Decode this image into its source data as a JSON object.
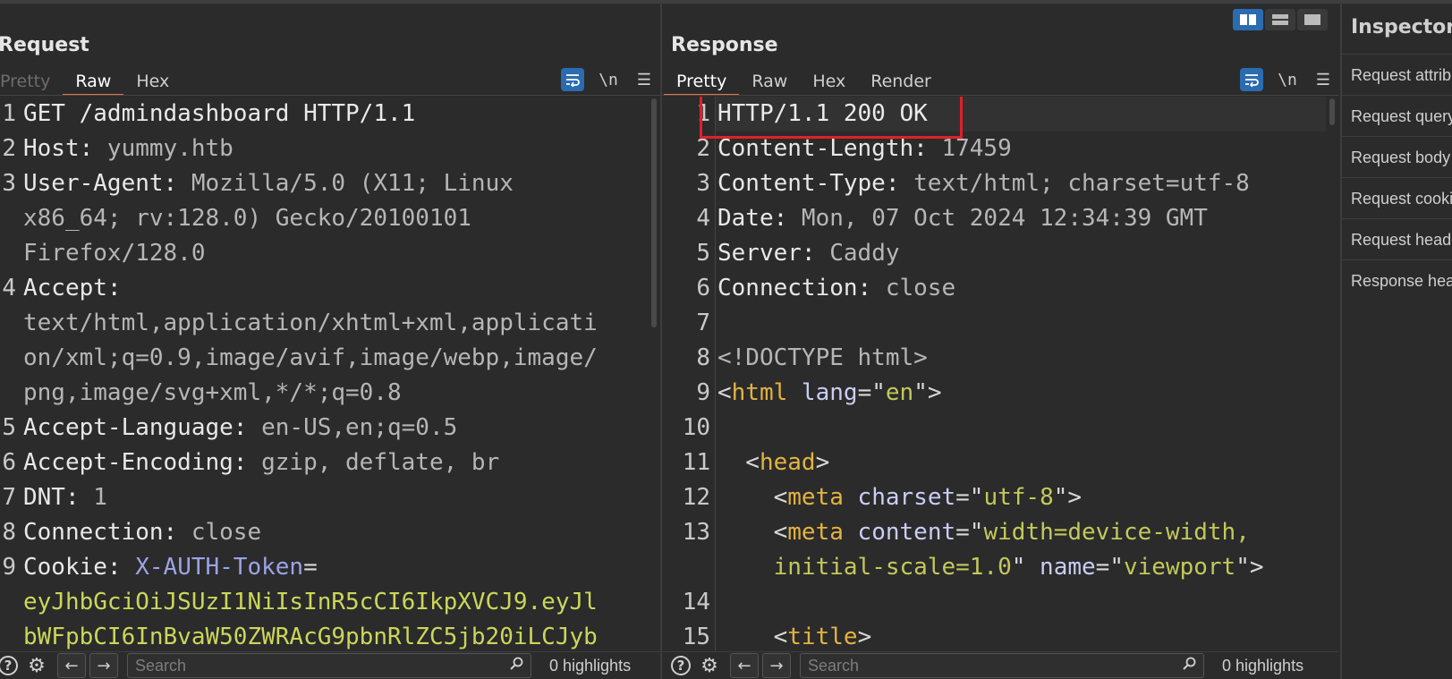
{
  "layout_toggle": {
    "icons": [
      "side-by-side-layout-icon",
      "stacked-layout-icon",
      "single-layout-icon"
    ],
    "active": 0
  },
  "request": {
    "title": "Request",
    "tabs": [
      "Pretty",
      "Raw",
      "Hex"
    ],
    "active_tab": "Raw",
    "toolbar": {
      "wrap_icon": "wrap-icon",
      "newline_label": "\\n",
      "menu_icon": "menu-icon"
    },
    "line_numbers": [
      "1",
      "2",
      "3",
      "",
      "",
      "4",
      "",
      "",
      "",
      "5",
      "6",
      "7",
      "8",
      "9",
      "",
      ""
    ],
    "lines": [
      {
        "segments": [
          {
            "t": "GET /admindashboard HTTP/1.1",
            "c": "tok"
          }
        ]
      },
      {
        "segments": [
          {
            "t": "Host: ",
            "c": "hn"
          },
          {
            "t": "yummy.htb",
            "c": "hv"
          }
        ]
      },
      {
        "segments": [
          {
            "t": "User-Agent: ",
            "c": "hn"
          },
          {
            "t": "Mozilla/5.0 (X11; Linux",
            "c": "hv"
          }
        ]
      },
      {
        "segments": [
          {
            "t": "x86_64; rv:128.0) Gecko/20100101",
            "c": "hv"
          }
        ]
      },
      {
        "segments": [
          {
            "t": "Firefox/128.0",
            "c": "hv"
          }
        ]
      },
      {
        "segments": [
          {
            "t": "Accept:",
            "c": "hn"
          }
        ]
      },
      {
        "segments": [
          {
            "t": "text/html,application/xhtml+xml,applicati",
            "c": "hv"
          }
        ]
      },
      {
        "segments": [
          {
            "t": "on/xml;q=0.9,image/avif,image/webp,image/",
            "c": "hv"
          }
        ]
      },
      {
        "segments": [
          {
            "t": "png,image/svg+xml,*/*;q=0.8",
            "c": "hv"
          }
        ]
      },
      {
        "segments": [
          {
            "t": "Accept-Language: ",
            "c": "hn"
          },
          {
            "t": "en-US,en;q=0.5",
            "c": "hv"
          }
        ]
      },
      {
        "segments": [
          {
            "t": "Accept-Encoding: ",
            "c": "hn"
          },
          {
            "t": "gzip, deflate, br",
            "c": "hv"
          }
        ]
      },
      {
        "segments": [
          {
            "t": "DNT: ",
            "c": "hn"
          },
          {
            "t": "1",
            "c": "hv"
          }
        ]
      },
      {
        "segments": [
          {
            "t": "Connection: ",
            "c": "hn"
          },
          {
            "t": "close",
            "c": "hv"
          }
        ]
      },
      {
        "segments": [
          {
            "t": "Cookie: ",
            "c": "hn"
          },
          {
            "t": "X-AUTH-Token",
            "c": "cv"
          },
          {
            "t": "=",
            "c": "punc"
          }
        ]
      },
      {
        "segments": [
          {
            "t": "eyJhbGciOiJSUzI1NiIsInR5cCI6IkpXVCJ9.eyJl",
            "c": "tkn"
          }
        ]
      },
      {
        "segments": [
          {
            "t": "bWFpbCI6InBvaW50ZWRAcG9pbnRlZC5jb20iLCJyb",
            "c": "tkn"
          }
        ]
      }
    ],
    "search_placeholder": "Search",
    "highlights": "0 highlights"
  },
  "response": {
    "title": "Response",
    "tabs": [
      "Pretty",
      "Raw",
      "Hex",
      "Render"
    ],
    "active_tab": "Pretty",
    "toolbar": {
      "wrap_icon": "wrap-icon",
      "newline_label": "\\n",
      "menu_icon": "menu-icon"
    },
    "line_numbers": [
      "1",
      "2",
      "3",
      "4",
      "5",
      "6",
      "7",
      "8",
      "9",
      "10",
      "11",
      "12",
      "13",
      "",
      "14",
      "15"
    ],
    "lines": [
      {
        "segments": [
          {
            "t": "HTTP/1.1 200 OK",
            "c": "tok"
          }
        ]
      },
      {
        "segments": [
          {
            "t": "Content-Length: ",
            "c": "hn"
          },
          {
            "t": "17459",
            "c": "hv"
          }
        ]
      },
      {
        "segments": [
          {
            "t": "Content-Type: ",
            "c": "hn"
          },
          {
            "t": "text/html; charset=utf-8",
            "c": "hv"
          }
        ]
      },
      {
        "segments": [
          {
            "t": "Date: ",
            "c": "hn"
          },
          {
            "t": "Mon, 07 Oct 2024 12:34:39 GMT",
            "c": "hv"
          }
        ]
      },
      {
        "segments": [
          {
            "t": "Server: ",
            "c": "hn"
          },
          {
            "t": "Caddy",
            "c": "hv"
          }
        ]
      },
      {
        "segments": [
          {
            "t": "Connection: ",
            "c": "hn"
          },
          {
            "t": "close",
            "c": "hv"
          }
        ]
      },
      {
        "segments": [
          {
            "t": "",
            "c": "hv"
          }
        ]
      },
      {
        "segments": [
          {
            "t": "<!DOCTYPE html>",
            "c": "hv"
          }
        ]
      },
      {
        "segments": [
          {
            "t": "<",
            "c": "punc"
          },
          {
            "t": "html",
            "c": "tag"
          },
          {
            "t": " lang",
            "c": "attr"
          },
          {
            "t": "=\"",
            "c": "punc"
          },
          {
            "t": "en",
            "c": "str"
          },
          {
            "t": "\">",
            "c": "punc"
          }
        ]
      },
      {
        "segments": [
          {
            "t": "",
            "c": "hv"
          }
        ]
      },
      {
        "segments": [
          {
            "t": "  <",
            "c": "punc"
          },
          {
            "t": "head",
            "c": "tag"
          },
          {
            "t": ">",
            "c": "punc"
          }
        ]
      },
      {
        "segments": [
          {
            "t": "    <",
            "c": "punc"
          },
          {
            "t": "meta",
            "c": "tag"
          },
          {
            "t": " charset",
            "c": "attr"
          },
          {
            "t": "=\"",
            "c": "punc"
          },
          {
            "t": "utf-8",
            "c": "str"
          },
          {
            "t": "\">",
            "c": "punc"
          }
        ]
      },
      {
        "segments": [
          {
            "t": "    <",
            "c": "punc"
          },
          {
            "t": "meta",
            "c": "tag"
          },
          {
            "t": " content",
            "c": "attr"
          },
          {
            "t": "=\"",
            "c": "punc"
          },
          {
            "t": "width=device-width,",
            "c": "str"
          }
        ]
      },
      {
        "segments": [
          {
            "t": "    ",
            "c": "punc"
          },
          {
            "t": "initial-scale=1.0",
            "c": "str"
          },
          {
            "t": "\" ",
            "c": "punc"
          },
          {
            "t": "name",
            "c": "attr"
          },
          {
            "t": "=\"",
            "c": "punc"
          },
          {
            "t": "viewport",
            "c": "str"
          },
          {
            "t": "\">",
            "c": "punc"
          }
        ]
      },
      {
        "segments": [
          {
            "t": "",
            "c": "hv"
          }
        ]
      },
      {
        "segments": [
          {
            "t": "    <",
            "c": "punc"
          },
          {
            "t": "title",
            "c": "tag"
          },
          {
            "t": ">",
            "c": "punc"
          }
        ]
      }
    ],
    "search_placeholder": "Search",
    "highlights": "0 highlights"
  },
  "inspector": {
    "title": "Inspector",
    "items": [
      "Request attributes",
      "Request query parameters",
      "Request body parameters",
      "Request cookies",
      "Request headers",
      "Response headers"
    ]
  },
  "colors": {
    "accent_tab": "#e8734b",
    "toolbar_blue": "#2b6cb0",
    "highlight_box": "#e0202a"
  }
}
